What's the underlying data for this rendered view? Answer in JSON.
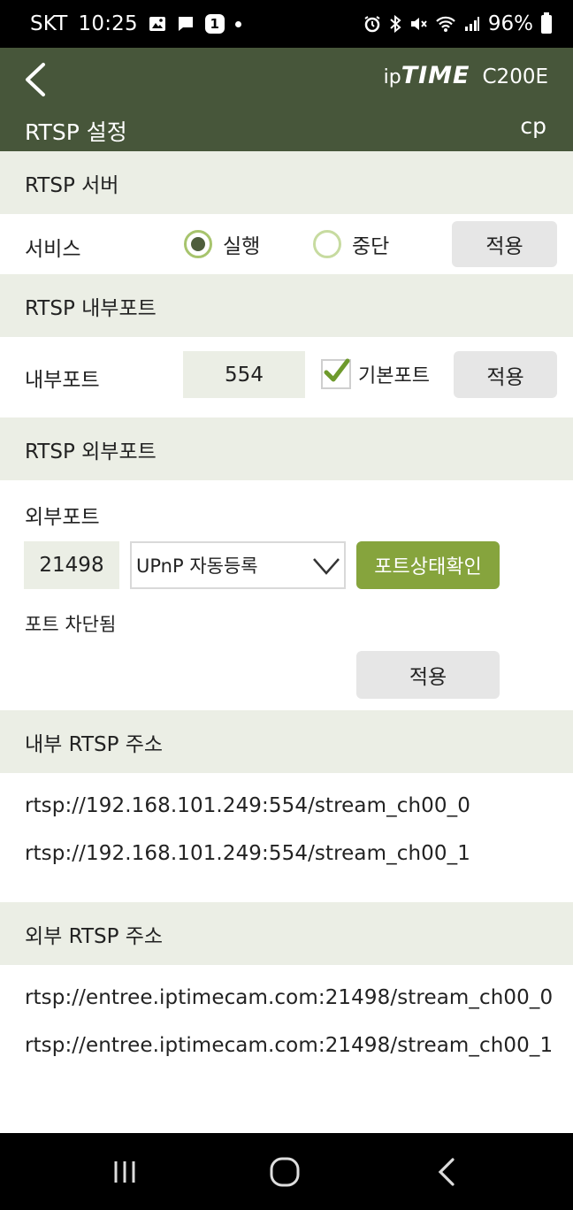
{
  "status_bar": {
    "carrier": "SKT",
    "time": "10:25",
    "notif_count": "1",
    "battery": "96%",
    "icons": [
      "gallery-icon",
      "message-icon",
      "alarm-icon",
      "bluetooth-icon",
      "mute-icon",
      "wifi-icon",
      "signal-icon",
      "battery-icon"
    ]
  },
  "header": {
    "brand_ip": "ip",
    "brand_time": "TIME",
    "model": "C200E",
    "title": "RTSP 설정",
    "user": "cp"
  },
  "server": {
    "section_title": "RTSP 서버",
    "service_label": "서비스",
    "run_label": "실행",
    "stop_label": "중단",
    "selected": "실행",
    "apply_label": "적용"
  },
  "internal_port": {
    "section_title": "RTSP 내부포트",
    "label": "내부포트",
    "value": "554",
    "default_label": "기본포트",
    "default_checked": true,
    "apply_label": "적용"
  },
  "external_port": {
    "section_title": "RTSP 외부포트",
    "label": "외부포트",
    "value": "21498",
    "mode_selected": "UPnP 자동등록",
    "check_button_label": "포트상태확인",
    "status": "포트 차단됨",
    "apply_label": "적용"
  },
  "internal_address": {
    "section_title": "내부 RTSP 주소",
    "urls": [
      "rtsp://192.168.101.249:554/stream_ch00_0",
      "rtsp://192.168.101.249:554/stream_ch00_1"
    ]
  },
  "external_address": {
    "section_title": "외부 RTSP 주소",
    "urls": [
      "rtsp://entree.iptimecam.com:21498/stream_ch00_0",
      "rtsp://entree.iptimecam.com:21498/stream_ch00_1"
    ]
  },
  "colors": {
    "header_bg": "#47563a",
    "section_bg": "#ebeee5",
    "accent_green": "#86a43d",
    "radio_fill": "#4e5e3c",
    "check_mark": "#6e9a2c"
  }
}
